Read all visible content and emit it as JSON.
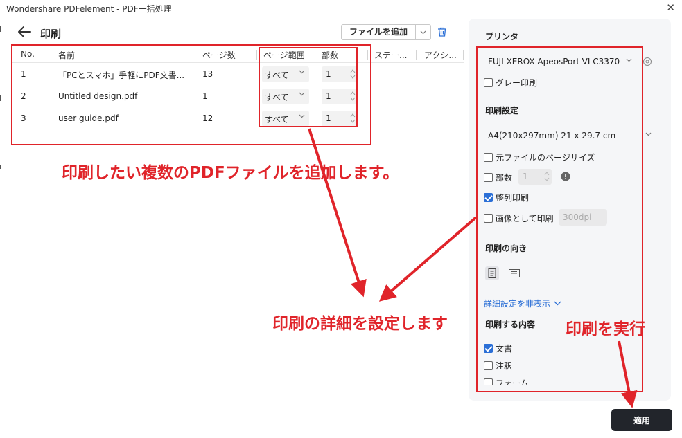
{
  "window": {
    "title": "Wondershare PDFelement - PDF一括処理",
    "close_glyph": "✕"
  },
  "header": {
    "title": "印刷",
    "add_file_label": "ファイルを追加"
  },
  "table": {
    "columns": [
      "No.",
      "名前",
      "ページ数",
      "ページ範囲",
      "部数",
      "ステー...",
      "アクシ..."
    ],
    "rows": [
      {
        "no": "1",
        "name": "「PCとスマホ」手軽にPDF文書...",
        "pages": "13",
        "range": "すべて",
        "copies": "1"
      },
      {
        "no": "2",
        "name": "Untitled design.pdf",
        "pages": "1",
        "range": "すべて",
        "copies": "1"
      },
      {
        "no": "3",
        "name": "user guide.pdf",
        "pages": "12",
        "range": "すべて",
        "copies": "1"
      }
    ]
  },
  "callouts": {
    "add_files": "印刷したい複数のPDFファイルを追加します。",
    "set_details": "印刷の詳細を設定します",
    "run_print": "印刷を実行"
  },
  "panel": {
    "printer_heading": "プリンタ",
    "printer_value": "FUJI XEROX ApeosPort-VI C3370",
    "gray_label": "グレー印刷",
    "gray_checked": false,
    "settings_heading": "印刷設定",
    "paper_value": "A4(210x297mm) 21 x 29.7 cm",
    "original_size_label": "元ファイルのページサイズ",
    "original_size_checked": false,
    "copies_label": "部数",
    "copies_checked": false,
    "copies_value": "1",
    "collate_label": "整列印刷",
    "collate_checked": true,
    "as_image_label": "画像として印刷",
    "as_image_checked": false,
    "dpi_value": "300dpi",
    "orientation_heading": "印刷の向き",
    "advanced_link": "詳細設定を非表示",
    "content_heading": "印刷する内容",
    "document_label": "文書",
    "document_checked": true,
    "annotation_label": "注釈",
    "annotation_checked": false,
    "form_label": "フォーム",
    "form_checked": false
  },
  "apply_label": "適用",
  "colors": {
    "annotation_red": "#e0242a",
    "accent_blue": "#2b6fd6",
    "apply_button": "#22252b",
    "panel_bg": "#f5f6f8"
  },
  "icons": [
    "back-arrow-icon",
    "chevron-down-icon",
    "trash-icon",
    "gear-icon",
    "info-icon",
    "portrait-icon",
    "landscape-icon",
    "spinner-icon"
  ]
}
